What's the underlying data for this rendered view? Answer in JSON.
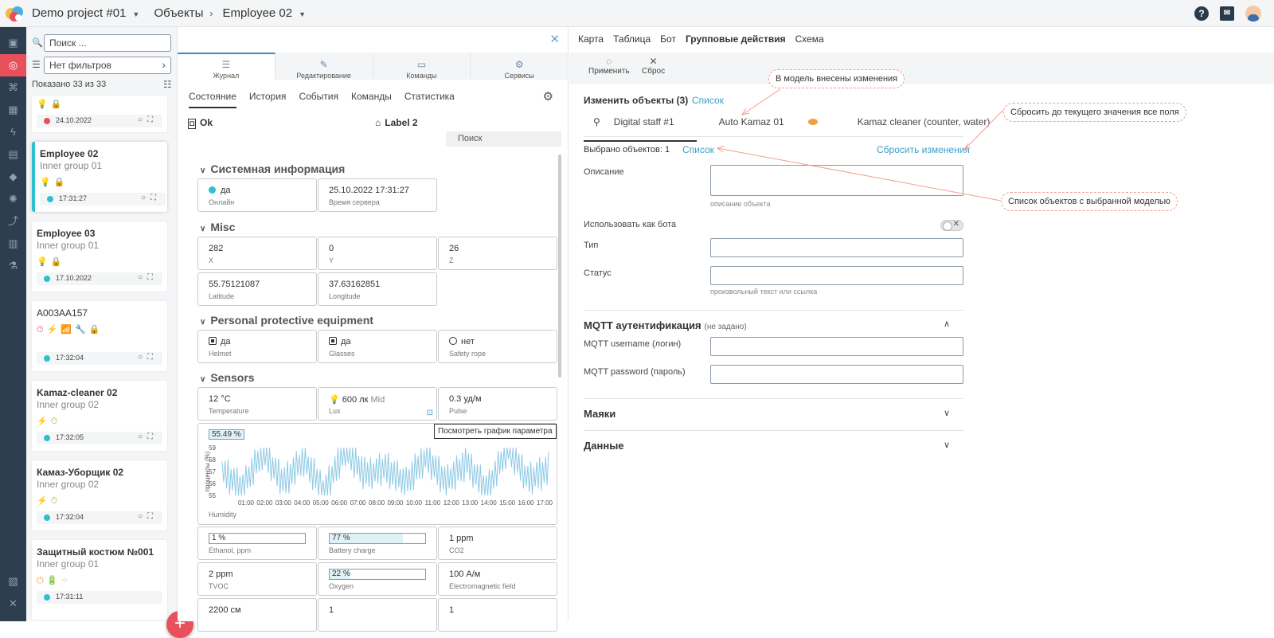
{
  "header": {
    "project": "Demo project #01",
    "crumb1": "Объекты",
    "crumb2": "Employee 02"
  },
  "left": {
    "search_placeholder": "Поиск ...",
    "filter_label": "Нет фильтров",
    "shown": "Показано 33 из 33",
    "cards": [
      {
        "name": "",
        "group": "",
        "status_time": "24.10.2022",
        "status_color": "#e8505b",
        "icons": "💡🔒"
      },
      {
        "name": "Employee 02",
        "group": "Inner group 01",
        "status_time": "17:31:27",
        "status_color": "#2ec0d0",
        "icons": "💡🔒"
      },
      {
        "name": "Employee 03",
        "group": "Inner group 01",
        "status_time": "17.10.2022",
        "status_color": "#2ec0d0",
        "icons": "💡🔒"
      },
      {
        "name": "A003AA157",
        "group": "",
        "status_time": "17:32:04",
        "status_color": "#2ec0d0",
        "icons": "⏱⚡📶🔧🔒"
      },
      {
        "name": "Kamaz-cleaner 02",
        "group": "Inner group 02",
        "status_time": "17:32:05",
        "status_color": "#2ec0d0",
        "icons": "⚡⏱"
      },
      {
        "name": "Камаз-Уборщик 02",
        "group": "Inner group 02",
        "status_time": "17:32:04",
        "status_color": "#2ec0d0",
        "icons": "⚡⏱"
      },
      {
        "name": "Защитный костюм №001",
        "group": "Inner group 01",
        "status_time": "17:31:11",
        "status_color": "#2ec0d0",
        "icons": "⏻🔋⁘"
      }
    ]
  },
  "middle": {
    "tabs": [
      "Журнал",
      "Редактирование",
      "Команды",
      "Сервисы"
    ],
    "subtabs": [
      "Состояние",
      "История",
      "События",
      "Команды",
      "Статистика"
    ],
    "ok": "Ok",
    "label2": "Label 2",
    "search": "Поиск",
    "sections": {
      "sys": "Системная информация",
      "misc": "Misc",
      "ppe": "Personal protective equipment",
      "sensors": "Sensors"
    },
    "sys": [
      {
        "v": "да",
        "l": "Онлайн"
      },
      {
        "v": "25.10.2022 17:31:27",
        "l": "Время сервера"
      }
    ],
    "misc": [
      {
        "v": "282",
        "l": "X"
      },
      {
        "v": "0",
        "l": "Y"
      },
      {
        "v": "26",
        "l": "Z"
      },
      {
        "v": "55.75121087",
        "l": "Latitude"
      },
      {
        "v": "37.63162851",
        "l": "Longitude"
      }
    ],
    "ppe": [
      {
        "v": "да",
        "l": "Helmet",
        "on": true
      },
      {
        "v": "да",
        "l": "Glasses",
        "on": true
      },
      {
        "v": "нет",
        "l": "Safety rope",
        "on": false
      }
    ],
    "sensors": [
      {
        "v": "12 °C",
        "l": "Temperature"
      },
      {
        "v": "600 лк",
        "v2": "Mid",
        "l": "Lux"
      },
      {
        "v": "0.3 уд/м",
        "l": "Pulse"
      }
    ],
    "humidity": {
      "value": "55.49 %",
      "label": "Humidity",
      "ylabel": "проценты (%)"
    },
    "tooltip": "Посмотреть график параметра",
    "row2": [
      {
        "v": "1 %",
        "l": "Ethanol, ppm",
        "pct": 1
      },
      {
        "v": "77 %",
        "l": "Battery charge",
        "pct": 77
      },
      {
        "v": "1 ppm",
        "l": "CO2"
      }
    ],
    "row3": [
      {
        "v": "2 ppm",
        "l": "TVOC"
      },
      {
        "v": "22 %",
        "l": "Oxygen",
        "pct": 22
      },
      {
        "v": "100 А/м",
        "l": "Electromagnetic field"
      }
    ],
    "row4": [
      {
        "v": "2200 см"
      },
      {
        "v": "1"
      },
      {
        "v": "1"
      }
    ]
  },
  "chart_data": {
    "type": "line",
    "title": "",
    "xlabel": "",
    "ylabel": "проценты (%)",
    "x": [
      "01:00",
      "02:00",
      "03:00",
      "04:00",
      "05:00",
      "06:00",
      "07:00",
      "08:00",
      "09:00",
      "10:00",
      "11:00",
      "12:00",
      "13:00",
      "14:00",
      "15:00",
      "16:00",
      "17:00"
    ],
    "yticks": [
      55,
      56,
      57,
      58,
      59
    ],
    "ylim": [
      55,
      59
    ],
    "series": [
      {
        "name": "Humidity",
        "color": "#8ecae6",
        "values": [
          57.1,
          55.6,
          58.6,
          56.2,
          57.9,
          55.4,
          58.8,
          56.7,
          57.4,
          55.9,
          58.3,
          56.1,
          57.7,
          55.5,
          58.9,
          56.4,
          57.2
        ]
      }
    ]
  },
  "right": {
    "tabs": [
      "Карта",
      "Таблица",
      "Бот",
      "Групповые действия",
      "Схема"
    ],
    "apply": "Применить",
    "reset_btn": "Сброс",
    "title": "Изменить объекты (3)",
    "list_link": "Список",
    "objects": [
      "Digital staff #1",
      "Auto Kamaz 01",
      "Kamaz cleaner (counter, water)"
    ],
    "selected": "Выбрано объектов: 1",
    "selected_link": "Список",
    "reset_changes": "Сбросить изменения",
    "desc_label": "Описание",
    "desc_hint": "описание объекта",
    "bot_label": "Использовать как бота",
    "type_label": "Тип",
    "status_label": "Статус",
    "status_hint": "произвольный текст или ссылка",
    "mqtt": "MQTT аутентификация",
    "mqtt_note": "(не задано)",
    "mqtt_user": "MQTT username (логин)",
    "mqtt_pass": "MQTT password (пароль)",
    "beacons": "Маяки",
    "data": "Данные",
    "notes": [
      "В модель внесены изменения",
      "Сбросить до текущего значения все поля",
      "Список объектов с выбранной моделью"
    ]
  },
  "colors": {
    "accent": "#2d8fd0",
    "link": "#3a9fc8",
    "danger": "#e8505b",
    "online": "#2ec0d0",
    "annotation": "#f0a090"
  }
}
